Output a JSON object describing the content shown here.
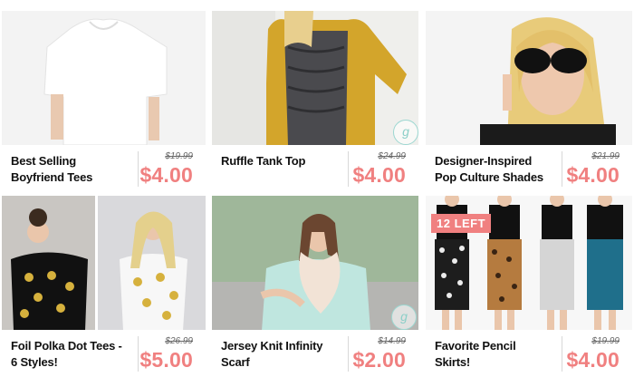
{
  "products": [
    {
      "title": "Best Selling Boyfriend Tees",
      "old_price": "$19.99",
      "price": "$4.00"
    },
    {
      "title": "Ruffle Tank Top",
      "old_price": "$24.99",
      "price": "$4.00"
    },
    {
      "title": "Designer-Inspired Pop Culture Shades",
      "old_price": "$21.99",
      "price": "$4.00"
    },
    {
      "title": "Foil Polka Dot Tees - 6 Styles!",
      "old_price": "$26.99",
      "price": "$5.00"
    },
    {
      "title": "Jersey Knit Infinity Scarf",
      "old_price": "$14.99",
      "price": "$2.00"
    },
    {
      "title": "Favorite Pencil Skirts!",
      "old_price": "$19.99",
      "price": "$4.00",
      "badge": "12 LEFT"
    }
  ],
  "watermark": "g",
  "colors": {
    "price": "#f08080",
    "text": "#111111",
    "divider": "#d8d8d8"
  }
}
